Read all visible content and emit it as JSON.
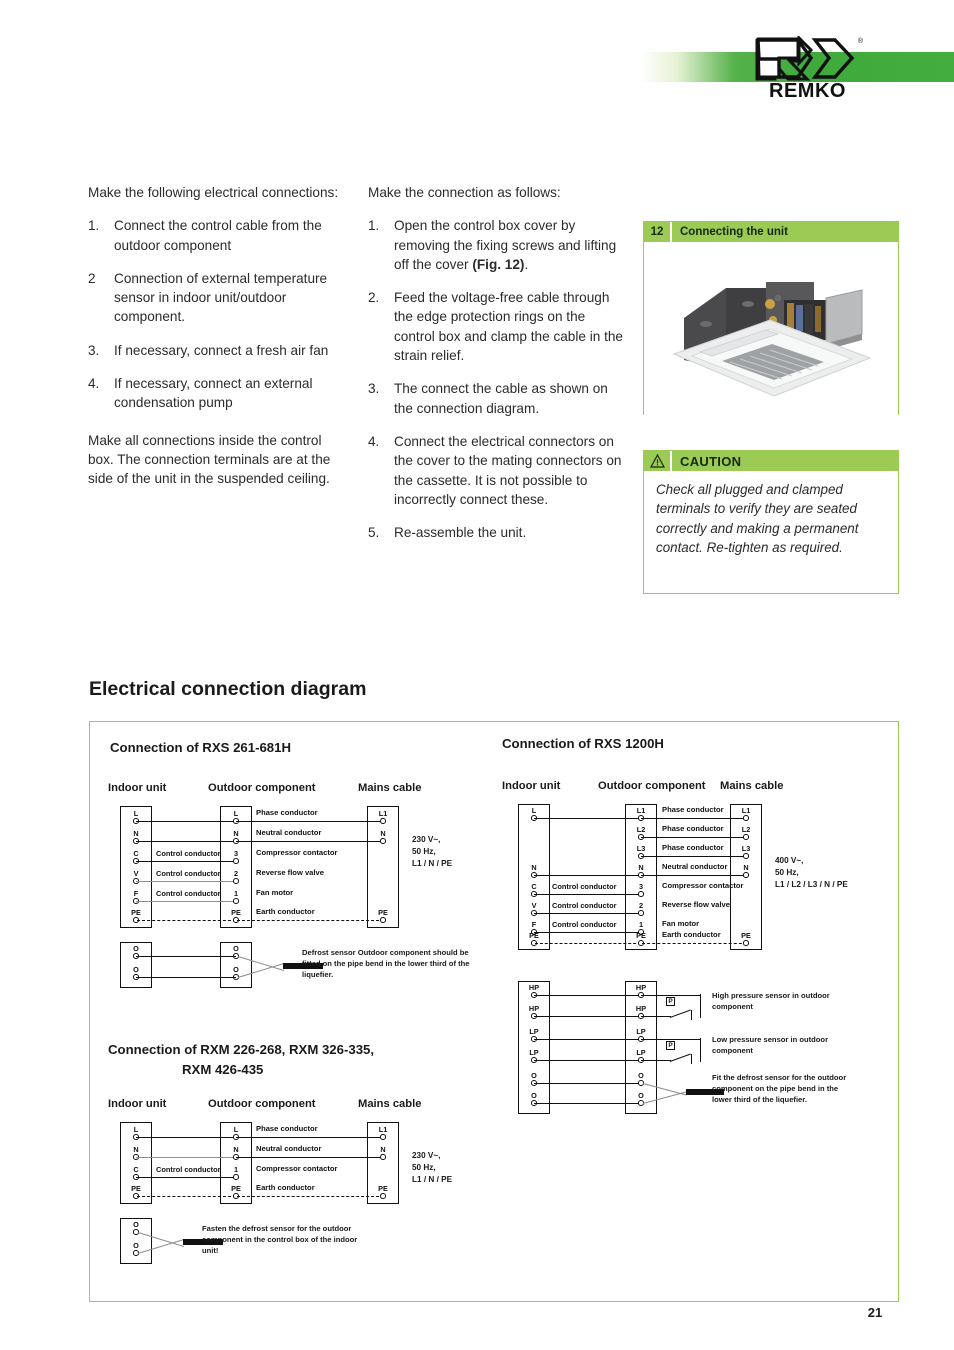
{
  "brand": {
    "logo_text": "REMKO",
    "registered_mark": "®",
    "accent_green": "#9bcb54",
    "bar_green": "#43ad3f"
  },
  "page": {
    "number": "21"
  },
  "column_left": {
    "intro": "Make the following electrical connections:",
    "items": [
      {
        "num": "1.",
        "text": "Connect the control cable from the outdoor component"
      },
      {
        "num": "2",
        "text": "Connection of external temperature sensor in indoor unit/outdoor component."
      },
      {
        "num": "3.",
        "text": "If necessary, connect a fresh air fan"
      },
      {
        "num": "4.",
        "text": "If necessary, connect an external condensation pump"
      }
    ],
    "outro": "Make all connections inside the control box. The connection terminals are at the side of the unit in the suspended ceiling."
  },
  "column_middle": {
    "intro": "Make the connection as follows:",
    "items": [
      {
        "num": "1.",
        "text": "Open the control box cover by removing the fixing screws and lifting off the cover ",
        "bold_tail": "(Fig. 12)",
        "tail": "."
      },
      {
        "num": "2.",
        "text": "Feed the voltage-free cable through the edge protection rings on the control box and clamp the cable in the strain relief."
      },
      {
        "num": "3.",
        "text": "The connect the cable as shown on the connection diagram."
      },
      {
        "num": "4.",
        "text": "Connect the electrical connectors on the cover to the mating connectors on the cassette. It is not possible to incorrectly connect these."
      },
      {
        "num": "5.",
        "text": "Re-assemble the unit."
      }
    ]
  },
  "figure": {
    "number": "12",
    "title": "Connecting the unit"
  },
  "caution": {
    "icon": "warning-triangle-icon",
    "title": "CAUTION",
    "text": "Check all plugged and clamped terminals to verify they are seated correctly and making a permanent contact. Re-tighten as required."
  },
  "section": {
    "heading": "Electrical connection diagram"
  },
  "diagrams": {
    "col_headers": {
      "indoor": "Indoor unit",
      "outdoor": "Outdoor component",
      "mains": "Mains cable"
    },
    "rxs261": {
      "title": "Connection of RXS 261-681H",
      "supply": "230 V~,\n50 Hz,\nL1 / N / PE",
      "rows": [
        {
          "indoor": "L",
          "outdoor": "L",
          "mains": "L1",
          "function": "Phase conductor",
          "mid": "",
          "wire": "black"
        },
        {
          "indoor": "N",
          "outdoor": "N",
          "mains": "N",
          "function": "Neutral conductor",
          "mid": "",
          "wire": "black"
        },
        {
          "indoor": "C",
          "outdoor": "3",
          "mains": "",
          "function": "Compressor contactor",
          "mid": "Control conductor",
          "wire": "black"
        },
        {
          "indoor": "V",
          "outdoor": "2",
          "mains": "",
          "function": "Reverse flow valve",
          "mid": "Control conductor",
          "wire": "gray"
        },
        {
          "indoor": "F",
          "outdoor": "1",
          "mains": "",
          "function": "Fan motor",
          "mid": "Control conductor",
          "wire": "gray"
        },
        {
          "indoor": "PE",
          "outdoor": "PE",
          "mains": "PE",
          "function": "Earth conductor",
          "mid": "",
          "wire": "dashdot"
        }
      ],
      "sensor": {
        "terminals": [
          "O",
          "O",
          "O",
          "O"
        ],
        "note": "Defrost sensor Outdoor component should be fitted on the pipe bend in the lower third of the liquefier."
      }
    },
    "rxm226": {
      "title": "Connection of RXM 226-268, RXM 326-335,",
      "title2": "RXM 426-435",
      "supply": "230 V~,\n50 Hz,\nL1 / N / PE",
      "rows": [
        {
          "indoor": "L",
          "outdoor": "L",
          "mains": "L1",
          "function": "Phase conductor",
          "mid": "",
          "wire": "black"
        },
        {
          "indoor": "N",
          "outdoor": "N",
          "mains": "N",
          "function": "Neutral conductor",
          "mid": "",
          "wire": "gray"
        },
        {
          "indoor": "C",
          "outdoor": "1",
          "mains": "",
          "function": "Compressor contactor",
          "mid": "Control conductor",
          "wire": "black"
        },
        {
          "indoor": "PE",
          "outdoor": "PE",
          "mains": "PE",
          "function": "Earth conductor",
          "mid": "",
          "wire": "dashdot"
        }
      ],
      "sensor": {
        "terminals": [
          "O",
          "O",
          "O",
          "O"
        ],
        "note": "Fasten the defrost sensor for the outdoor component in the control box of the indoor unit!"
      }
    },
    "rxs1200": {
      "title": "Connection of RXS 1200H",
      "supply": "400 V~,\n50 Hz,\nL1 / L2 / L3 / N / PE",
      "rows": [
        {
          "indoor": "L",
          "outdoor": "L1",
          "mains": "L1",
          "function": "Phase conductor",
          "mid": "",
          "wire": "black"
        },
        {
          "indoor": "",
          "outdoor": "L2",
          "mains": "L2",
          "function": "Phase conductor",
          "mid": "",
          "wire": "black"
        },
        {
          "indoor": "",
          "outdoor": "L3",
          "mains": "L3",
          "function": "Phase conductor",
          "mid": "",
          "wire": "black"
        },
        {
          "indoor": "N",
          "outdoor": "N",
          "mains": "N",
          "function": "Neutral conductor",
          "mid": "",
          "wire": "black"
        },
        {
          "indoor": "C",
          "outdoor": "3",
          "mains": "",
          "function": "Compressor contactor",
          "mid": "Control conductor",
          "wire": "black"
        },
        {
          "indoor": "V",
          "outdoor": "2",
          "mains": "",
          "function": "Reverse flow valve",
          "mid": "Control conductor",
          "wire": "black"
        },
        {
          "indoor": "F",
          "outdoor": "1",
          "mains": "",
          "function": "Fan motor",
          "mid": "Control conductor",
          "wire": "black"
        },
        {
          "indoor": "PE",
          "outdoor": "PE",
          "mains": "PE",
          "function": "Earth conductor",
          "mid": "",
          "wire": "dashdot"
        }
      ],
      "sensors": {
        "hp": {
          "terminals": [
            "HP",
            "HP"
          ],
          "symbol": "P",
          "note": "High pressure sensor in outdoor component"
        },
        "lp": {
          "terminals": [
            "LP",
            "LP"
          ],
          "symbol": "P",
          "note": "Low pressure sensor in outdoor component"
        },
        "defrost": {
          "terminals": [
            "O",
            "O",
            "O",
            "O"
          ],
          "note": "Fit the defrost sensor for the outdoor component on the pipe bend in the lower third of the liquefier."
        }
      }
    }
  }
}
